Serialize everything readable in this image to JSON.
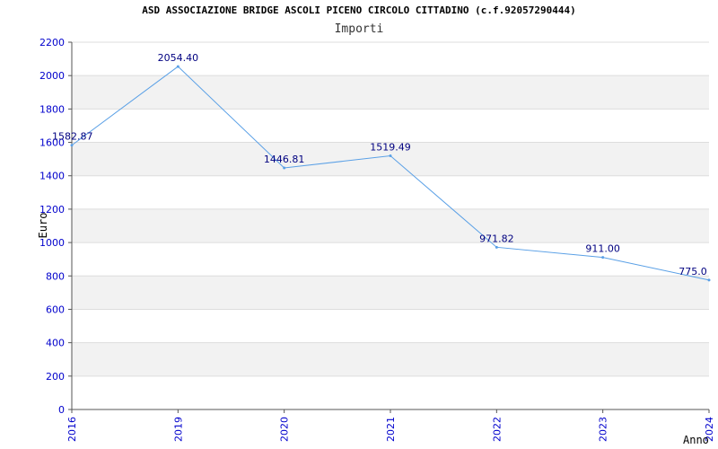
{
  "title": "ASD ASSOCIAZIONE BRIDGE ASCOLI PICENO CIRCOLO CITTADINO (c.f.92057290444)",
  "subtitle": "Importi",
  "colors": {
    "line": "#5aa0e6",
    "band": "#f2f2f2",
    "grid": "#dddddd",
    "axis": "#555555",
    "tick_text": "#0000cc",
    "label_text": "#000080"
  },
  "chart_data": {
    "type": "line",
    "title": "ASD ASSOCIAZIONE BRIDGE ASCOLI PICENO CIRCOLO CITTADINO (c.f.92057290444)",
    "subtitle": "Importi",
    "xlabel": "Anno",
    "ylabel": "Euro",
    "categories": [
      "2016",
      "2019",
      "2020",
      "2021",
      "2022",
      "2023",
      "2024"
    ],
    "series": [
      {
        "values": [
          1582.87,
          2054.4,
          1446.81,
          1519.49,
          971.82,
          911.0,
          775.0
        ],
        "labels": [
          "1582.87",
          "2054.40",
          "1446.81",
          "1519.49",
          "971.82",
          "911.00",
          "775.0"
        ]
      }
    ],
    "ylim": [
      0,
      2200
    ],
    "yticks": [
      "0",
      "200",
      "400",
      "600",
      "800",
      "1000",
      "1200",
      "1400",
      "1600",
      "1800",
      "2000",
      "2200"
    ],
    "grid": true,
    "legend": "none"
  }
}
